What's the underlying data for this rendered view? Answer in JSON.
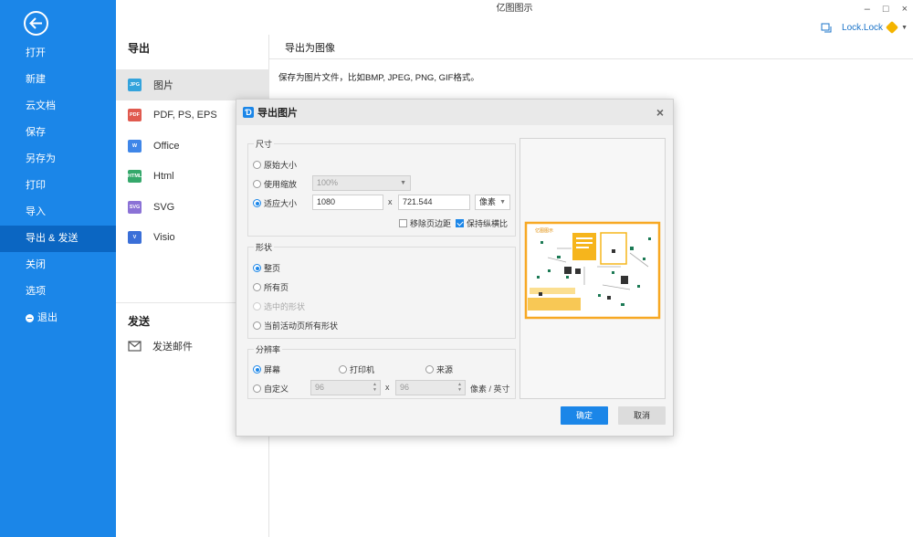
{
  "window": {
    "title": "亿图图示",
    "controls": [
      "–",
      "□",
      "×"
    ],
    "user": "Lock.Lock"
  },
  "sidebar": {
    "items": [
      {
        "label": "打开"
      },
      {
        "label": "新建"
      },
      {
        "label": "云文档"
      },
      {
        "label": "保存"
      },
      {
        "label": "另存为"
      },
      {
        "label": "打印"
      },
      {
        "label": "导入"
      },
      {
        "label": "导出 & 发送"
      },
      {
        "label": "关闭"
      },
      {
        "label": "选项"
      },
      {
        "label": "退出"
      }
    ]
  },
  "middle": {
    "heading": "导出",
    "items": [
      {
        "label": "图片",
        "icon_text": "JPG",
        "color": "#33a3dc"
      },
      {
        "label": "PDF, PS, EPS",
        "icon_text": "PDF",
        "color": "#e05a4f"
      },
      {
        "label": "Office",
        "icon_text": "W",
        "color": "#3f86e8"
      },
      {
        "label": "Html",
        "icon_text": "HTML",
        "color": "#35a86b"
      },
      {
        "label": "SVG",
        "icon_text": "SVG",
        "color": "#8b72d6"
      },
      {
        "label": "Visio",
        "icon_text": "V",
        "color": "#3a6fd8"
      }
    ],
    "send_heading": "发送",
    "send_item": "发送邮件"
  },
  "right": {
    "heading": "导出为图像",
    "description": "保存为图片文件，比如BMP, JPEG, PNG, GIF格式。"
  },
  "dialog": {
    "title": "导出图片",
    "size_group": {
      "title": "尺寸",
      "original": "原始大小",
      "scale": "使用缩放",
      "scale_value": "100%",
      "fit": "适应大小",
      "width": "1080",
      "x": "x",
      "height": "721.544",
      "unit": "像素",
      "remove_margin": "移除页边距",
      "keep_ratio": "保持纵横比"
    },
    "shape_group": {
      "title": "形状",
      "whole_page": "整页",
      "all_pages": "所有页",
      "selected": "选中的形状",
      "current_page_all": "当前活动页所有形状"
    },
    "resolution_group": {
      "title": "分辨率",
      "screen": "屏幕",
      "printer": "打印机",
      "source": "来源",
      "custom": "自定义",
      "dpi_x": "96",
      "dpi_y": "96",
      "dpi_unit": "像素 / 英寸"
    },
    "preview_title": "亿图图示",
    "ok": "确定",
    "cancel": "取消"
  }
}
